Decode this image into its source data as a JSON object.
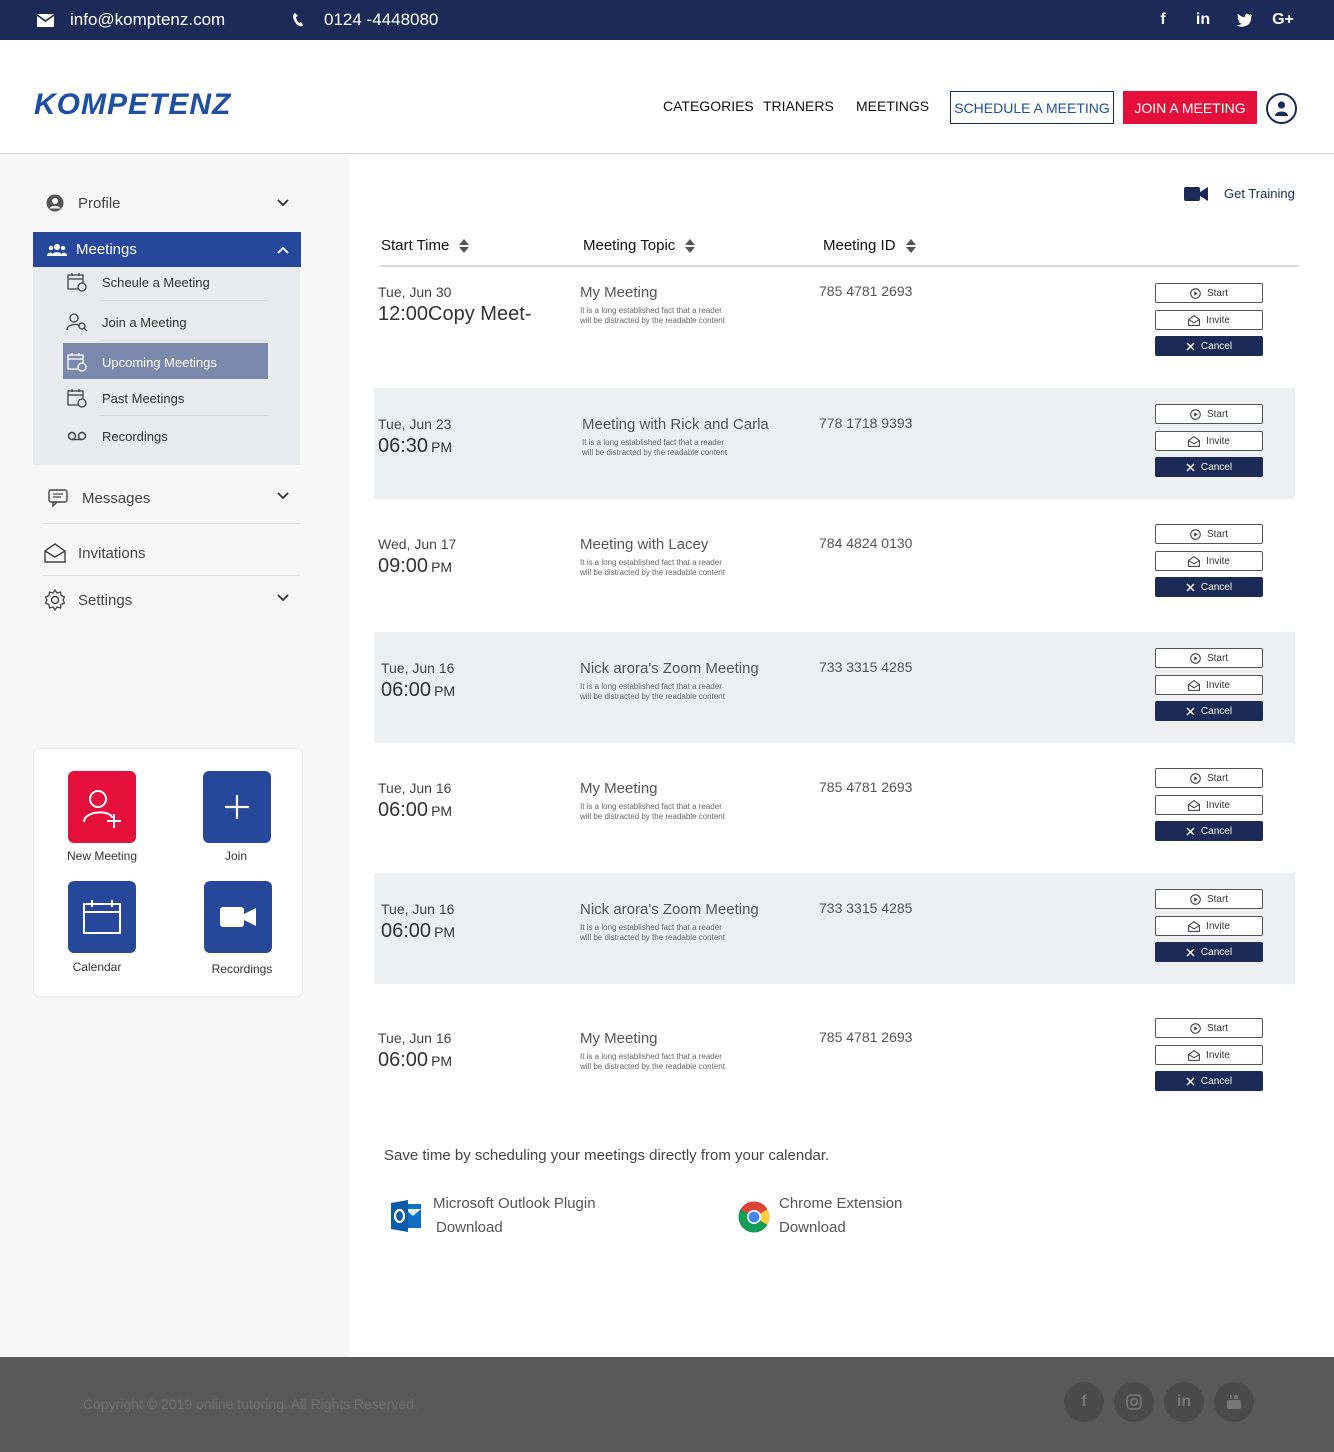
{
  "topbar": {
    "email": "info@komptenz.com",
    "phone": "0124 -4448080",
    "social": [
      "f",
      "in",
      "twitter",
      "G+"
    ]
  },
  "header": {
    "logo": "KOMPETENZ",
    "nav": [
      "CATEGORIES",
      "TRIANERS",
      "MEETINGS"
    ],
    "schedule_label": "SCHEDULE A MEETING",
    "join_label": "JOIN A MEETING"
  },
  "sidebar": {
    "profile": "Profile",
    "meetings": "Meetings",
    "sub": [
      "Scheule a Meeting",
      "Join a Meeting",
      "Upcoming Meetings",
      "Past Meetings",
      "Recordings"
    ],
    "messages": "Messages",
    "invitations": "Invitations",
    "settings": "Settings"
  },
  "quick": {
    "new_meeting": "New Meeting",
    "join": "Join",
    "calendar": "Calendar",
    "recordings": "Recordings"
  },
  "main": {
    "get_training": "Get Training",
    "headers": {
      "start": "Start Time",
      "topic": "Meeting Topic",
      "id": "Meeting ID"
    },
    "btn_start": "Start",
    "btn_invite": "Invite",
    "btn_cancel": "Cancel",
    "rows": [
      {
        "date": "Tue, Jun 30",
        "time": "12:00Copy Meet-",
        "pm": "",
        "topic": "My Meeting",
        "desc1": "It is a long established fact that a reader",
        "desc2": "will be distracted by the readable content",
        "id": "785 4781 2693"
      },
      {
        "date": "Tue, Jun 23",
        "time": "06:30",
        "pm": "PM",
        "topic": "Meeting with Rick and Carla",
        "desc1": "It is a long established fact that a reader",
        "desc2": "will be distracted by the readable content",
        "id": "778 1718 9393"
      },
      {
        "date": "Wed, Jun 17",
        "time": "09:00",
        "pm": "PM",
        "topic": "Meeting with Lacey",
        "desc1": "It is a long established fact that a reader",
        "desc2": "will be distracted by the readable content",
        "id": "784 4824 0130"
      },
      {
        "date": "Tue, Jun 16",
        "time": "06:00",
        "pm": "PM",
        "topic": "Nick arora's Zoom Meeting",
        "desc1": "It is a long established fact that a reader",
        "desc2": "will be distracted by the readable content",
        "id": "733 3315 4285"
      },
      {
        "date": "Tue, Jun 16",
        "time": "06:00",
        "pm": "PM",
        "topic": "My Meeting",
        "desc1": "It is a long established fact that a reader",
        "desc2": "will be distracted by the readable content",
        "id": "785 4781 2693"
      },
      {
        "date": "Tue, Jun 16",
        "time": "06:00",
        "pm": "PM",
        "topic": "Nick arora's Zoom Meeting",
        "desc1": "It is a long established fact that a reader",
        "desc2": "will be distracted by the readable content",
        "id": "733 3315 4285"
      },
      {
        "date": "Tue, Jun 16",
        "time": "06:00",
        "pm": "PM",
        "topic": "My Meeting",
        "desc1": "It is a long established fact that a reader",
        "desc2": "will be distracted by the readable content",
        "id": "785 4781 2693"
      }
    ],
    "save_text": "Save time by scheduling your meetings directly from your calendar.",
    "outlook_title": "Microsoft Outlook Plugin",
    "outlook_link": "Download",
    "chrome_title": "Chrome Extension",
    "chrome_link": "Download"
  },
  "footer": {
    "copyright": "Copyright © 2019 online tutoring. All Rights Reserved."
  },
  "colors": {
    "navy": "#1b2a57",
    "accent_blue": "#27479a",
    "red": "#e4103b"
  }
}
